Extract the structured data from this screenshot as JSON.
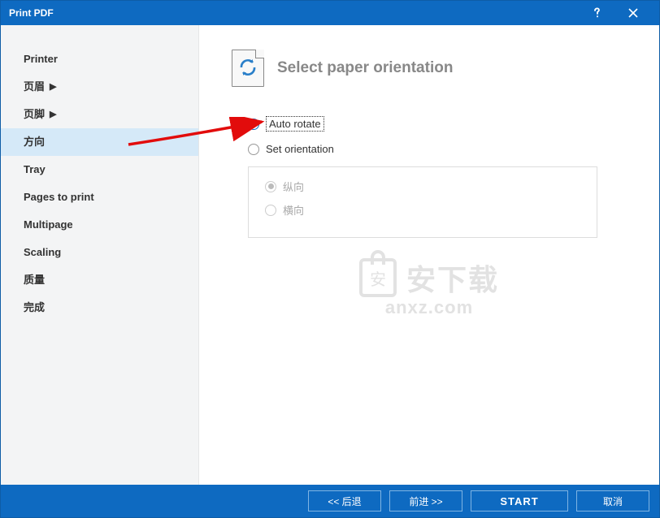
{
  "title": "Print PDF",
  "sidebar": {
    "items": [
      {
        "label": "Printer",
        "has_arrow": false
      },
      {
        "label": "页眉",
        "has_arrow": true
      },
      {
        "label": "页脚",
        "has_arrow": true
      },
      {
        "label": "方向",
        "has_arrow": false,
        "selected": true
      },
      {
        "label": "Tray",
        "has_arrow": false
      },
      {
        "label": "Pages to print",
        "has_arrow": false
      },
      {
        "label": "Multipage",
        "has_arrow": false
      },
      {
        "label": "Scaling",
        "has_arrow": false
      },
      {
        "label": "质量",
        "has_arrow": false
      },
      {
        "label": "完成",
        "has_arrow": false
      }
    ]
  },
  "main": {
    "heading": "Select paper orientation",
    "radios": {
      "auto_rotate": "Auto rotate",
      "set_orientation": "Set orientation"
    },
    "sub": {
      "portrait": "纵向",
      "landscape": "横向"
    }
  },
  "watermark": {
    "text_top": "安下载",
    "text_bottom": "anxz.com",
    "badge_glyph": "安"
  },
  "footer": {
    "back": "<<  后退",
    "next": "前进  >>",
    "start": "START",
    "cancel": "取消"
  }
}
